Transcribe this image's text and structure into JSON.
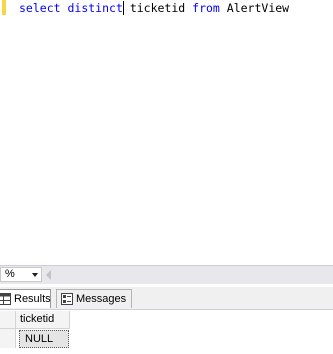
{
  "editor": {
    "query": {
      "keyword_select": "select",
      "keyword_distinct": "distinct",
      "column": "ticketid",
      "keyword_from": "from",
      "table": "AlertView"
    }
  },
  "zoom": {
    "value": "%"
  },
  "results_tabs": [
    {
      "label": "Results",
      "icon": "grid-icon",
      "selected": true
    },
    {
      "label": "Messages",
      "icon": "messages-icon",
      "selected": false
    }
  ],
  "grid": {
    "columns": [
      "ticketid"
    ],
    "rows": [
      [
        "NULL"
      ]
    ]
  },
  "colors": {
    "keyword": "#0000ff",
    "change_marker": "#f7d64a"
  }
}
